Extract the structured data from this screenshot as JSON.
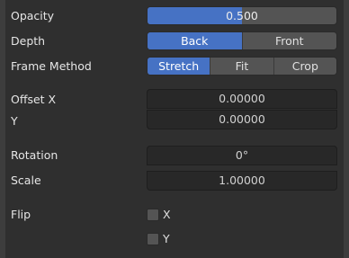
{
  "properties": {
    "opacity": {
      "label": "Opacity",
      "value": "0.500",
      "fraction": 0.5
    },
    "depth": {
      "label": "Depth",
      "options": [
        "Back",
        "Front"
      ],
      "selected": "Back"
    },
    "frame_method": {
      "label": "Frame Method",
      "options": [
        "Stretch",
        "Fit",
        "Crop"
      ],
      "selected": "Stretch"
    },
    "offset_x": {
      "label": "Offset X",
      "value": "0.00000"
    },
    "offset_y": {
      "label": "Y",
      "value": "0.00000"
    },
    "rotation": {
      "label": "Rotation",
      "value": "0°"
    },
    "scale": {
      "label": "Scale",
      "value": "1.00000"
    },
    "flip": {
      "label": "Flip",
      "x_label": "X",
      "y_label": "Y",
      "x_checked": false,
      "y_checked": false
    }
  },
  "colors": {
    "accent": "#4672c4",
    "panel_bg": "#2f2f2f",
    "field_bg": "#282828"
  }
}
